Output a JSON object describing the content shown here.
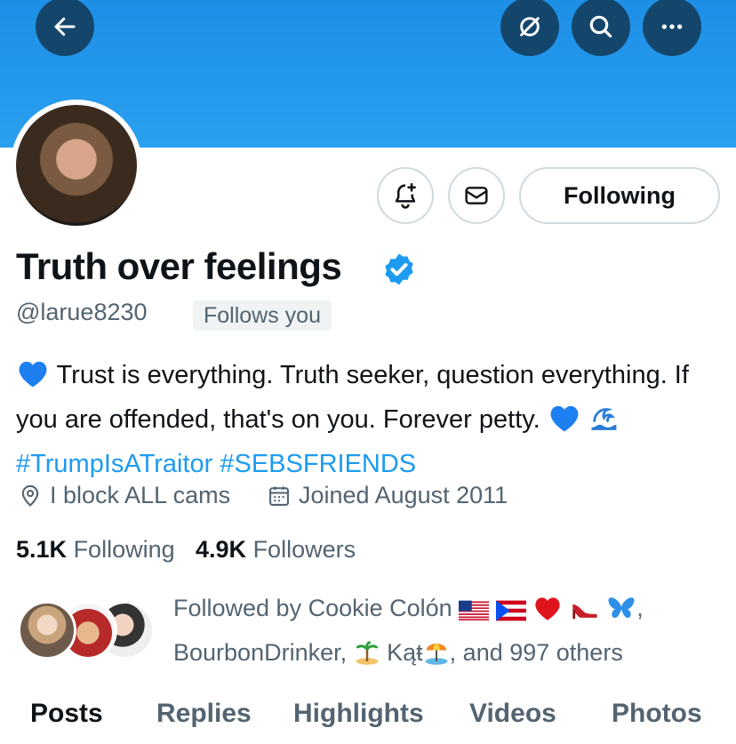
{
  "header": {
    "back_icon": "arrow-left-icon",
    "hide_icon": "eye-slash-icon",
    "search_icon": "search-icon",
    "more_icon": "more-icon"
  },
  "profile": {
    "display_name": "Truth over feelings",
    "handle": "@larue8230",
    "follows_you": "Follows you",
    "following_label": "Following",
    "bio_text": "Trust is everything. Truth seeker, question everything. If you are offended, that's on you. Forever petty.",
    "hashtags": [
      "#TrumpIsATraitor",
      "#SEBSFRIENDS"
    ],
    "location": "I block ALL cams",
    "joined": "Joined August 2011"
  },
  "stats": {
    "following_count": "5.1K",
    "following_label": "Following",
    "followers_count": "4.9K",
    "followers_label": "Followers"
  },
  "followed_by": {
    "prefix": "Followed by Cookie Colón",
    "second_line_start": "BourbonDrinker,",
    "name3": "Kąŧ",
    "suffix": ", and 997 others"
  },
  "tabs": [
    "Posts",
    "Replies",
    "Highlights",
    "Videos",
    "Photos"
  ],
  "colors": {
    "banner": "#1d8fe6",
    "accent": "#1d9bf0",
    "button_dark": "#14466b"
  }
}
